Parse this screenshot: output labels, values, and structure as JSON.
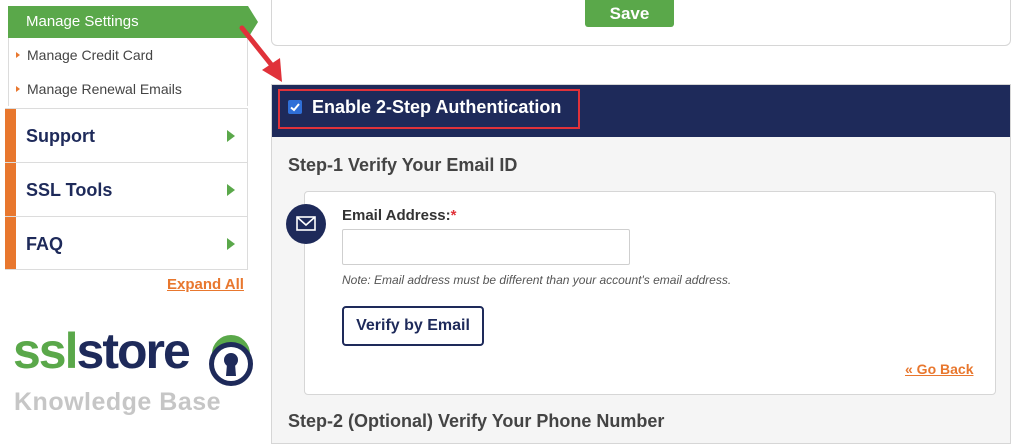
{
  "sidebar": {
    "active_item": "Manage Settings",
    "sub_items": [
      "Manage Credit Card",
      "Manage Renewal Emails"
    ],
    "main_items": [
      "Support",
      "SSL Tools",
      "FAQ"
    ],
    "expand_all": "Expand All"
  },
  "logo": {
    "ssl": "ssl",
    "store": "store",
    "kb": "Knowledge Base"
  },
  "top": {
    "save_label": "Save"
  },
  "panel": {
    "enable_label": "Enable 2-Step Authentication",
    "enable_checked": true,
    "step1_title": "Step-1 Verify Your Email ID",
    "email_label": "Email Address:",
    "required_mark": "*",
    "email_value": "",
    "note": "Note: Email address must be different than your account's email address.",
    "verify_button": "Verify by Email",
    "go_back": "« Go Back",
    "step2_title": "Step-2 (Optional) Verify Your Phone Number"
  },
  "colors": {
    "brand_green": "#5aa84a",
    "navy": "#1e2a5a",
    "orange": "#e8772e",
    "highlight_red": "#e0323a"
  },
  "icons": [
    "bullet-arrow-icon",
    "chevron-right-icon",
    "checkbox-icon",
    "envelope-icon",
    "pointer-arrow-icon",
    "keyhole-lock-icon"
  ]
}
